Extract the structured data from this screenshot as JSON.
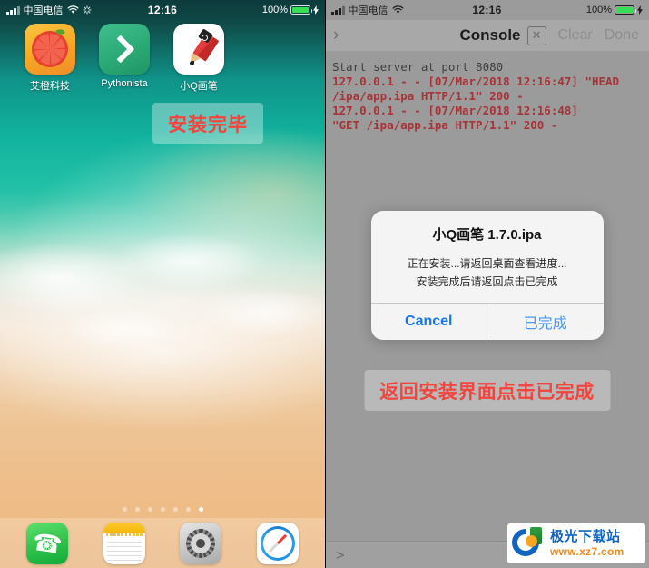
{
  "left_phone": {
    "status_bar": {
      "carrier": "中国电信",
      "time": "12:16",
      "battery_percent": "100%",
      "signal_icon": "signal-bars-icon",
      "wifi_icon": "wifi-icon",
      "location_icon": "location-spinner-icon",
      "charging_icon": "charging-bolt-icon"
    },
    "apps": [
      {
        "label": "艾橙科技",
        "icon": "orange-citrus-app-icon"
      },
      {
        "label": "Pythonista",
        "icon": "pythonista-chevron-app-icon"
      },
      {
        "label": "小Q画笔",
        "icon": "red-pencil-app-icon"
      }
    ],
    "annotation": "安装完毕",
    "page_dots": {
      "count": 7,
      "active_index": 6
    },
    "dock": [
      {
        "label": "Phone",
        "icon": "phone-icon"
      },
      {
        "label": "Notes",
        "icon": "notes-icon"
      },
      {
        "label": "Settings",
        "icon": "gear-icon"
      },
      {
        "label": "Safari",
        "icon": "compass-icon"
      }
    ]
  },
  "right_phone": {
    "status_bar": {
      "carrier": "中国电信",
      "time": "12:16",
      "battery_percent": "100%"
    },
    "nav": {
      "back_icon": "chevron-right-icon",
      "title": "Console",
      "close_label": "✕",
      "clear_label": "Clear",
      "done_label": "Done"
    },
    "console_log": [
      {
        "text": "Start server at port 8080",
        "style": "plain"
      },
      {
        "text": "127.0.0.1 - - [07/Mar/2018 12:16:47] \"HEAD",
        "style": "red"
      },
      {
        "text": "/ipa/app.ipa HTTP/1.1\" 200 -",
        "style": "red"
      },
      {
        "text": "127.0.0.1 - - [07/Mar/2018 12:16:48]",
        "style": "red"
      },
      {
        "text": "\"GET /ipa/app.ipa HTTP/1.1\" 200 -",
        "style": "red"
      }
    ],
    "prompt_symbol": ">",
    "alert": {
      "title": "小Q画笔 1.7.0.ipa",
      "message_line1": "正在安装...请返回桌面查看进度...",
      "message_line2": "安装完成后请返回点击已完成",
      "cancel_label": "Cancel",
      "done_label": "已完成"
    },
    "annotation": "返回安装界面点击已完成"
  },
  "watermark": {
    "name": "极光下载站",
    "url": "www.xz7.com"
  },
  "colors": {
    "annotation_red": "#f1453d",
    "alert_blue": "#1278f1",
    "log_red": "#a83236",
    "battery_green": "#36e054"
  }
}
